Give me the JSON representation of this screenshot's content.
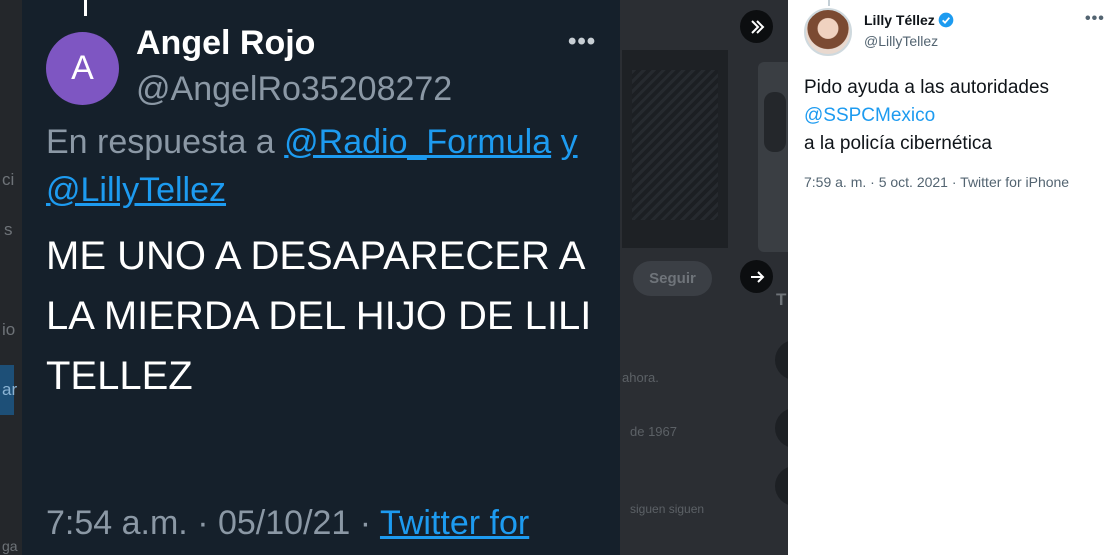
{
  "background": {
    "seguir_label": "Seguir",
    "frag_a": "ci",
    "frag_b": "s",
    "frag_c": "io",
    "frag_d": "ar",
    "frag_e": "ahora.",
    "frag_f": "de 1967",
    "frag_g": "siguen  siguen",
    "frag_h": "T",
    "frag_i": "ga"
  },
  "dark_tweet": {
    "name": "Angel Rojo",
    "handle": "@AngelRo35208272",
    "avatar_letter": "A",
    "more_label": "•••",
    "reply_prefix": "En respuesta a",
    "reply_mention_1": "@Radio_Formula",
    "reply_conj": "y",
    "reply_mention_2": "@LillyTellez",
    "body": "ME UNO A DESAPARECER A LA MIERDA DEL HIJO DE LILI TELLEZ",
    "time": "7:54 a.m.",
    "sep": "·",
    "date": "05/10/21",
    "source": "Twitter for"
  },
  "panel_tweet": {
    "name": "Lilly Téllez",
    "handle": "@LillyTellez",
    "more_label": "•••",
    "text_line_1": "Pido ayuda a las autoridades",
    "mention": "@SSPCMexico",
    "text_line_3": "a la policía cibernética",
    "meta": "7:59 a. m. · 5 oct. 2021 · Twitter for iPhone"
  },
  "icons": {
    "collapse": "double-chevron-right-icon",
    "next": "arrow-right-icon",
    "verified": "verified-badge-icon",
    "more": "more-horizontal-icon"
  },
  "colors": {
    "twitter_blue": "#1d9bf0",
    "dim_bg": "#15202b",
    "avatar_purple": "#7e56c2"
  }
}
